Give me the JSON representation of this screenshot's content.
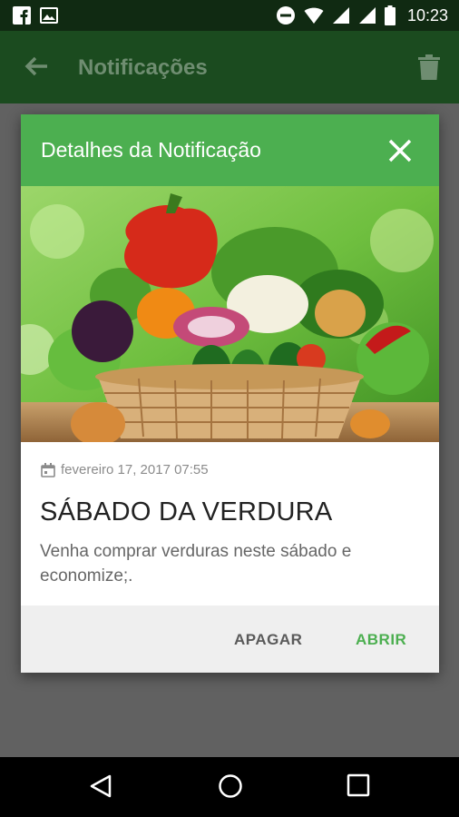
{
  "status_bar": {
    "time": "10:23"
  },
  "app_bar": {
    "title": "Notificações"
  },
  "dialog": {
    "title": "Detalhes da Notificação",
    "date": "fevereiro 17, 2017 07:55",
    "headline": "SÁBADO DA VERDURA",
    "body": "Venha comprar verduras neste sábado e economize;.",
    "actions": {
      "delete_label": "APAGAR",
      "open_label": "ABRIR"
    }
  },
  "colors": {
    "accent_green": "#4caf50",
    "app_bar_dimmed": "#1b4b1f",
    "status_bar_dimmed": "#102a12",
    "scrim_gray": "#616161"
  }
}
